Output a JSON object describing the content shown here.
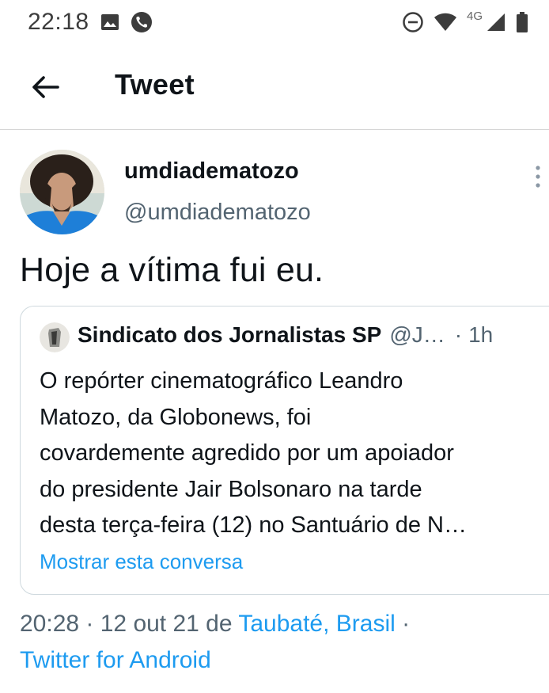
{
  "status_bar": {
    "time": "22:18",
    "left_icons": [
      "image-icon",
      "phone-call-icon"
    ],
    "network_label": "4G",
    "right_icons": [
      "do-not-disturb-icon",
      "wifi-icon",
      "cell-signal-icon",
      "battery-icon"
    ]
  },
  "header": {
    "title": "Tweet",
    "back_icon": "arrow-left-icon"
  },
  "tweet": {
    "display_name": "umdiadematozo",
    "handle": "@umdiadematozo",
    "text": "Hoje a vítima fui eu.",
    "more_icon": "more-vertical-icon"
  },
  "quoted_tweet": {
    "author_name": "Sindicato dos Jornalistas SP",
    "author_handle": "@J…",
    "separator": "·",
    "time": "1h",
    "lines": [
      "O repórter cinematográfico Leandro",
      "Matozo, da Globonews, foi",
      "covardemente agredido por um apoiador",
      "do presidente Jair Bolsonaro na tarde",
      "desta terça-feira (12) no Santuário de N…"
    ],
    "show_thread_label": "Mostrar esta conversa"
  },
  "meta": {
    "timestamp": "20:28 · 12 out 21 de",
    "location": "Taubaté, Brasil",
    "dot": "·",
    "source": "Twitter for Android"
  },
  "colors": {
    "link": "#1d9bf0",
    "secondary_text": "#536471",
    "primary_text": "#0f1419",
    "divider": "#cfd9de"
  }
}
